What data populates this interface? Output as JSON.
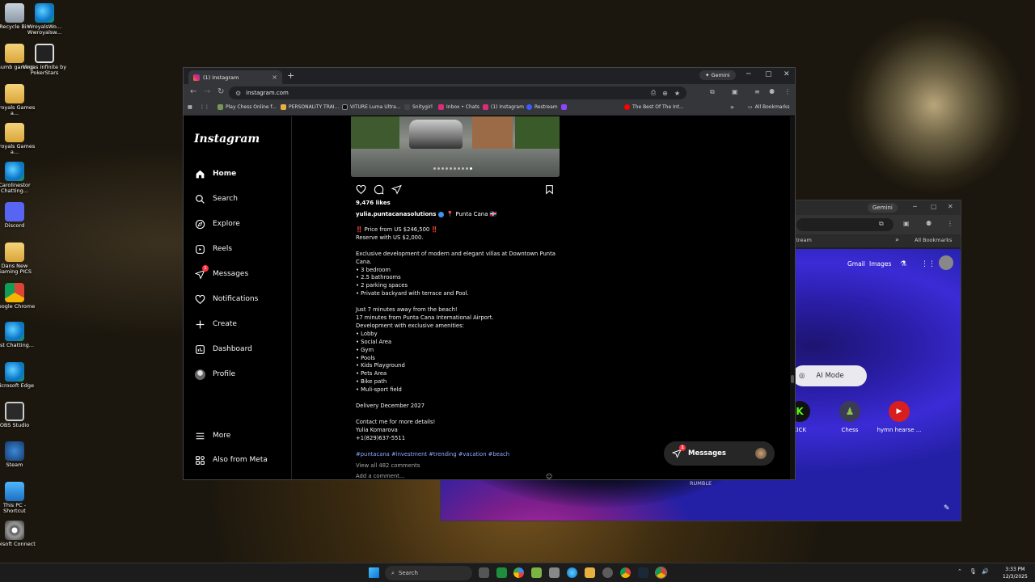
{
  "desktop": {
    "icons": [
      {
        "label": "Recycle Bin"
      },
      {
        "label": "WroyalsWo... Wwroyalsw..."
      },
      {
        "label": "thumb gaming"
      },
      {
        "label": "Vegas Infinite by PokerStars"
      },
      {
        "label": "Wroyals Games a..."
      },
      {
        "label": "Wroyals Games a..."
      },
      {
        "label": "Carolinestor Chatting..."
      },
      {
        "label": "Discord"
      },
      {
        "label": "Dans New Gaming PICS"
      },
      {
        "label": "Google Chrome"
      },
      {
        "label": "Just Chatting..."
      },
      {
        "label": "Microsoft Edge"
      },
      {
        "label": "OBS Studio"
      },
      {
        "label": "Steam"
      },
      {
        "label": "This PC - Shortcut"
      },
      {
        "label": "Ubisoft Connect"
      }
    ]
  },
  "back_window": {
    "gemini": "Gemini",
    "bookmark_left": "stream",
    "bookmarks_all": "All Bookmarks",
    "links": {
      "gmail": "Gmail",
      "images": "Images"
    },
    "ai_mode": "AI Mode",
    "shortcuts": [
      {
        "label": "KICK",
        "glyph": "K"
      },
      {
        "label": "Chess",
        "glyph": "♟"
      },
      {
        "label": "hymn hearse ...",
        "glyph": "▶"
      }
    ],
    "rumble": "RUMBLE"
  },
  "browser": {
    "tab_title": "(1) Instagram",
    "tab_close": "×",
    "new_tab": "+",
    "gemini": "Gemini",
    "url": "instagram.com",
    "bookmarks": [
      {
        "label": "Play Chess Online f...",
        "color": "#769656"
      },
      {
        "label": "PERSONALITY TRAI...",
        "color": "#e6b13c"
      },
      {
        "label": "VITURE Luma Ultra...",
        "color": "#111111"
      },
      {
        "label": "Snitygirl",
        "color": "#444444"
      },
      {
        "label": "Inbox • Chats",
        "color": "#dd2a7b"
      },
      {
        "label": "(1) Instagram",
        "color": "#dd2a7b"
      },
      {
        "label": "Restream",
        "color": "#3b5bff"
      },
      {
        "label": "The Best Of The Int...",
        "color": "#ff0000"
      }
    ],
    "bookmarks_all": "All Bookmarks"
  },
  "instagram": {
    "logo": "Instagram",
    "nav": [
      {
        "label": "Home",
        "icon": "home-icon",
        "active": true
      },
      {
        "label": "Search",
        "icon": "search-icon"
      },
      {
        "label": "Explore",
        "icon": "explore-icon"
      },
      {
        "label": "Reels",
        "icon": "reels-icon"
      },
      {
        "label": "Messages",
        "icon": "messages-icon",
        "badge": "1"
      },
      {
        "label": "Notifications",
        "icon": "heart-icon"
      },
      {
        "label": "Create",
        "icon": "plus-icon"
      },
      {
        "label": "Dashboard",
        "icon": "dashboard-icon"
      },
      {
        "label": "Profile",
        "icon": "avatar"
      }
    ],
    "nav_bottom": [
      {
        "label": "More",
        "icon": "menu-icon"
      },
      {
        "label": "Also from Meta",
        "icon": "meta-icon"
      }
    ],
    "post": {
      "carousel_total": 10,
      "carousel_current": 10,
      "likes": "9,476 likes",
      "username": "yulia.puntacanasolutions",
      "location": "📍 Punta Cana 🇩🇴",
      "caption": "‼️ Price from US $246,500 ‼️\nReserve with US $2,000.\n\nExclusive development of modern and elegant villas at Downtown Punta Cana.\n• 3 bedroom\n• 2.5 bathrooms\n• 2 parking spaces\n• Private backyard with terrace and Pool.\n\nJust 7 minutes away from the beach!\n17 minutes from Punta Cana International Airport.\nDevelopment with exclusive amenities:\n• Lobby\n• Social Area\n• Gym\n• Pools\n• Kids Playground\n• Pets Area\n• Bike path\n• Muli-sport field\n\nDelivery December 2027\n\nContact me for more details!\nYulia Komarova\n+1(829)637-5511",
      "hashtags": "#puntacana #investment #trending #vacation #beach",
      "view_comments": "View all 482 comments",
      "add_comment": "Add a comment..."
    },
    "messages_pill": {
      "label": "Messages",
      "badge": "1"
    }
  },
  "taskbar": {
    "search": "Search",
    "time": "3:33 PM",
    "date": "12/3/2025"
  }
}
